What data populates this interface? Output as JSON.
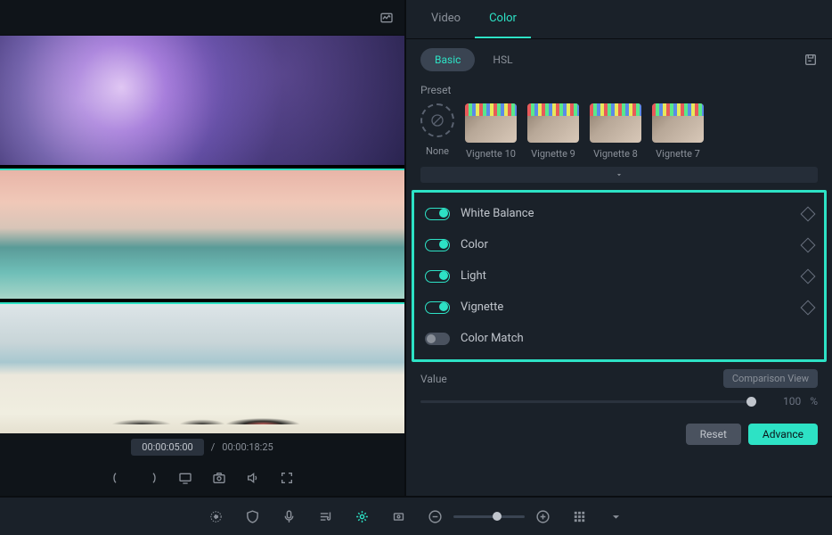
{
  "tabs": {
    "video": "Video",
    "color": "Color"
  },
  "subtabs": {
    "basic": "Basic",
    "hsl": "HSL"
  },
  "preset": {
    "label": "Preset",
    "none": "None",
    "items": [
      "Vignette 10",
      "Vignette 9",
      "Vignette 8",
      "Vignette 7"
    ]
  },
  "adjustments": {
    "white_balance": "White Balance",
    "color": "Color",
    "light": "Light",
    "vignette": "Vignette",
    "color_match": "Color Match"
  },
  "value": {
    "label": "Value",
    "comparison": "Comparison View",
    "amount": "100",
    "unit": "%"
  },
  "actions": {
    "reset": "Reset",
    "advance": "Advance"
  },
  "timeline": {
    "current": "00:00:05:00",
    "sep": "/",
    "total": "00:00:18:25"
  }
}
